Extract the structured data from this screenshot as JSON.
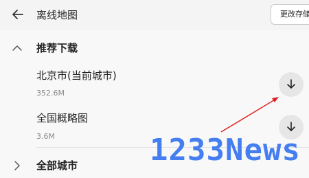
{
  "header": {
    "back_icon": "back-arrow-icon",
    "title": "离线地图",
    "change_storage_label": "更改存储"
  },
  "recommended": {
    "label": "推荐下载",
    "icon": "chevron-up-icon",
    "items": [
      {
        "name": "北京市(当前城市)",
        "size": "352.6M",
        "icon": "download-icon"
      },
      {
        "name": "全国概略图",
        "size": "3.6M",
        "icon": "download-icon"
      }
    ]
  },
  "all_cities": {
    "label": "全部城市",
    "icon": "chevron-right-icon"
  },
  "annotation": {
    "color": "#e02020"
  },
  "watermark": {
    "text": "1233News",
    "color": "#3c78f0"
  }
}
